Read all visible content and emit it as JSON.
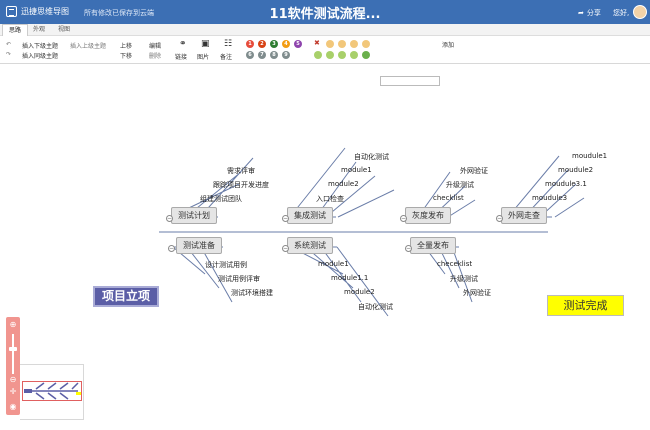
{
  "app": {
    "name": "迅捷思维导图",
    "save_status": "所有修改已保存到云端",
    "doc_title": "11软件测试流程..."
  },
  "header": {
    "share_label": "分享",
    "greeting": "您好,"
  },
  "tabs": [
    {
      "label": "思路",
      "active": true
    },
    {
      "label": "外观",
      "active": false
    },
    {
      "label": "视图",
      "active": false
    }
  ],
  "toolbar": {
    "insert_child": "插入下级主题",
    "insert_parent": "插入上级主题",
    "insert_sibling": "插入同级主题",
    "move_up": "上移",
    "move_down": "下移",
    "edit": "编辑",
    "delete": "删除",
    "link": "链接",
    "image": "图片",
    "note": "备注",
    "search_button": "添加",
    "priorities": [
      {
        "num": "1",
        "color": "#e74c3c"
      },
      {
        "num": "2",
        "color": "#d84315"
      },
      {
        "num": "3",
        "color": "#2e7d32"
      },
      {
        "num": "4",
        "color": "#f39c12"
      },
      {
        "num": "5",
        "color": "#8e44ad"
      },
      {
        "num": "6",
        "color": "#7f8c8d"
      },
      {
        "num": "7",
        "color": "#7f8c8d"
      },
      {
        "num": "8",
        "color": "#7f8c8d"
      },
      {
        "num": "9",
        "color": "#7f8c8d"
      }
    ],
    "progress_colors": [
      "#f2c77a",
      "#f2c77a",
      "#f2c77a",
      "#f2c77a",
      "#a8d06a",
      "#a8d06a",
      "#a8d06a",
      "#a8d06a",
      "#6ab04c"
    ]
  },
  "mindmap": {
    "root": "项目立项",
    "end": "测试完成",
    "main_nodes": {
      "test_plan": "测试计划",
      "integration_test": "集成测试",
      "gray_release": "灰度发布",
      "external_verify": "外网走查",
      "test_prep": "测试准备",
      "system_test": "系统测试",
      "full_release": "全量发布"
    },
    "leaves": {
      "test_plan": [
        "需求评审",
        "跟踪项目开发进度",
        "组建测试团队"
      ],
      "integration_test": [
        "自动化测试",
        "module1",
        "module2",
        "入口检查"
      ],
      "gray_release": [
        "外网验证",
        "升级测试",
        "checklist"
      ],
      "external_verify": [
        "moudule1",
        "moudule2",
        "moudule3.1",
        "moudule3"
      ],
      "test_prep": [
        "设计测试用例",
        "测试用例评审",
        "测试环境搭建"
      ],
      "system_test": [
        "module1",
        "module1.1",
        "module2",
        "自动化测试"
      ],
      "full_release": [
        "checeklist",
        "升级测试",
        "外网验证"
      ]
    }
  }
}
